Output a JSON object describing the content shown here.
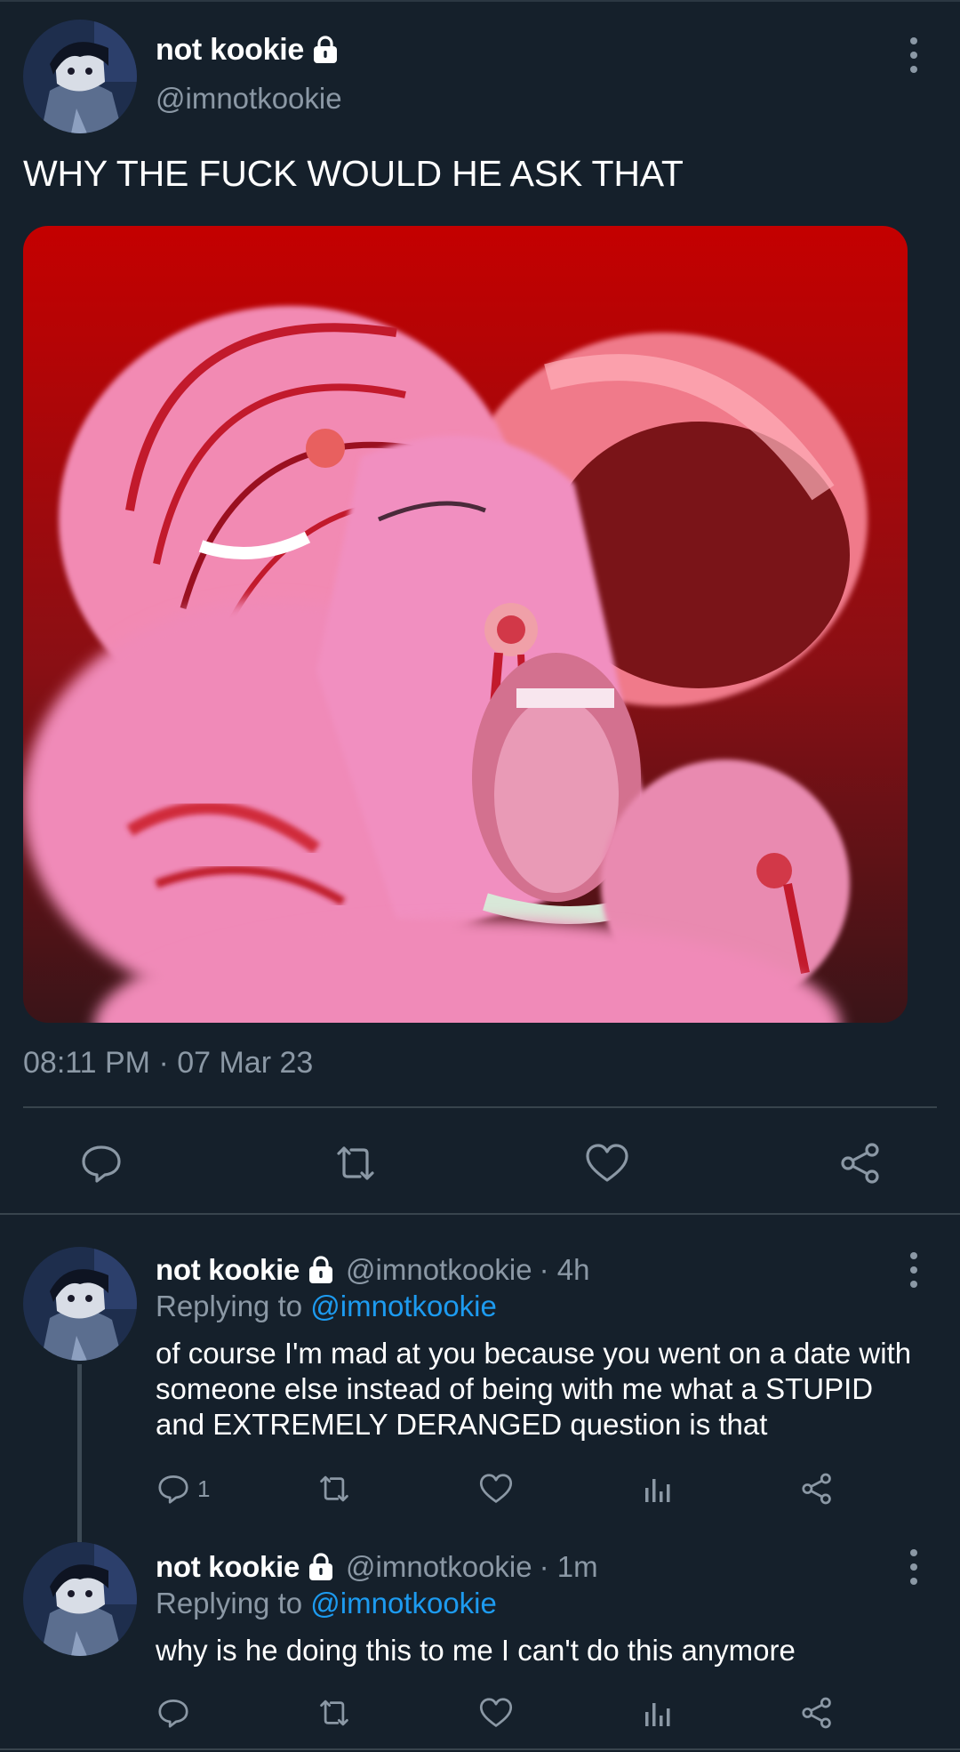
{
  "main_tweet": {
    "author_name": "not kookie",
    "author_handle": "@imnotkookie",
    "text": "WHY THE FUCK WOULD HE ASK THAT",
    "timestamp": "08:11 PM · 07 Mar 23",
    "actions": [
      "reply-icon",
      "retweet-icon",
      "like-icon",
      "share-icon"
    ]
  },
  "replies": [
    {
      "author_name": "not kookie",
      "author_handle": "@imnotkookie",
      "time": "· 4h",
      "replying_prefix": "Replying to ",
      "replying_to": "@imnotkookie",
      "text": "of course I'm mad at you because you went on a date with someone else instead of being with me what a STUPID and EXTREMELY DERANGED question is that",
      "reply_count": "1"
    },
    {
      "author_name": "not kookie",
      "author_handle": "@imnotkookie",
      "time": "· 1m",
      "replying_prefix": "Replying to ",
      "replying_to": "@imnotkookie",
      "text": "why is he doing this to me I can't do this anymore",
      "reply_count": ""
    }
  ],
  "colors": {
    "background": "#15202b",
    "text_primary": "#ffffff",
    "text_secondary": "#8b98a5",
    "link": "#1d9bf0",
    "divider": "#38444d"
  }
}
